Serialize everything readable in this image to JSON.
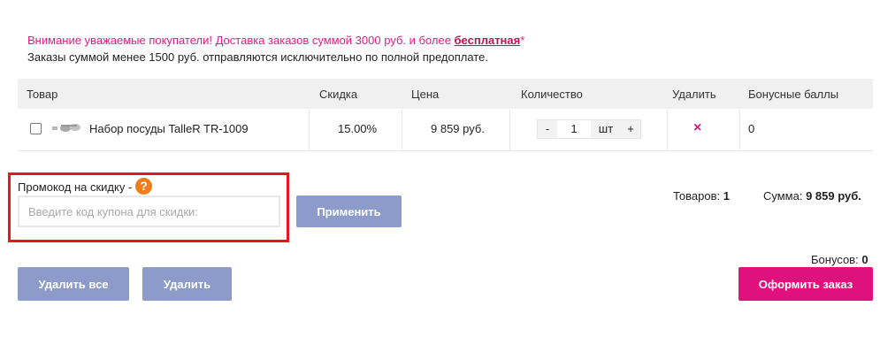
{
  "notice": {
    "line1_text": "Внимание уважаемые покупатели! Доставка заказов суммой 3000 руб. и более ",
    "line1_link": "бесплатная",
    "line1_star": "*",
    "line2": "Заказы суммой менее 1500 руб. отправляются исключительно по полной предоплате."
  },
  "table": {
    "headers": [
      "Товар",
      "Скидка",
      "Цена",
      "Количество",
      "Удалить",
      "Бонусные баллы"
    ],
    "rows": [
      {
        "product": "Набор посуды TalleR TR-1009",
        "discount": "15.00%",
        "price": "9 859 руб.",
        "qty_minus": "-",
        "qty": "1",
        "unit": "шт",
        "qty_plus": "+",
        "delete": "×",
        "bonus": "0"
      }
    ]
  },
  "promo": {
    "label": "Промокод на скидку -",
    "help": "?",
    "placeholder": "Введите код купона для скидки:",
    "apply": "Применить"
  },
  "totals": {
    "goods_label": "Товаров:",
    "goods_value": "1",
    "sum_label": "Сумма:",
    "sum_value": "9 859 руб.",
    "bonus_label": "Бонусов:",
    "bonus_value": "0"
  },
  "actions": {
    "delete_all": "Удалить все",
    "delete": "Удалить",
    "checkout": "Оформить заказ"
  },
  "colors": {
    "accent": "#e0117c",
    "button": "#8c9bc9",
    "highlight": "#e6161c",
    "help": "#f07c1b"
  }
}
